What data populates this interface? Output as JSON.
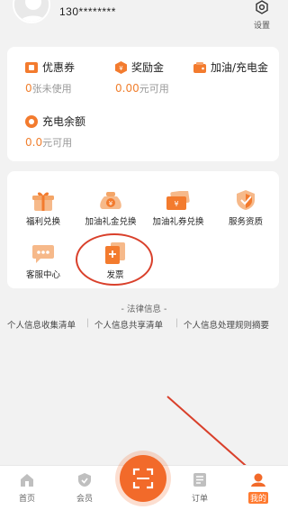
{
  "header": {
    "phone": "130********",
    "settings_label": "设置"
  },
  "wallet": {
    "coupons": {
      "title": "优惠券",
      "value": "0",
      "unit": "张未使用"
    },
    "bonus": {
      "title": "奖励金",
      "value": "0.00",
      "unit": "元可用"
    },
    "fuel_charge": {
      "title": "加油/充电金"
    },
    "charge_balance": {
      "title": "充电余额",
      "value": "0.0",
      "unit": "元可用"
    }
  },
  "services": [
    {
      "label": "福利兑换",
      "icon": "gift-icon"
    },
    {
      "label": "加油礼金兑换",
      "icon": "coin-bag-icon"
    },
    {
      "label": "加油礼券兑换",
      "icon": "ticket-icon"
    },
    {
      "label": "服务资质",
      "icon": "shield-check-icon"
    },
    {
      "label": "客服中心",
      "icon": "chat-icon"
    },
    {
      "label": "发票",
      "icon": "invoice-icon"
    }
  ],
  "legal": {
    "title": "- 法律信息 -",
    "links": [
      "个人信息收集清单",
      "个人信息共享清单",
      "个人信息处理规则摘要"
    ]
  },
  "tabbar": {
    "home": "首页",
    "member": "会员",
    "orders": "订单",
    "mine": "我的"
  },
  "colors": {
    "accent": "#f26a2a",
    "value": "#f08030",
    "annotation": "#d9402b"
  }
}
